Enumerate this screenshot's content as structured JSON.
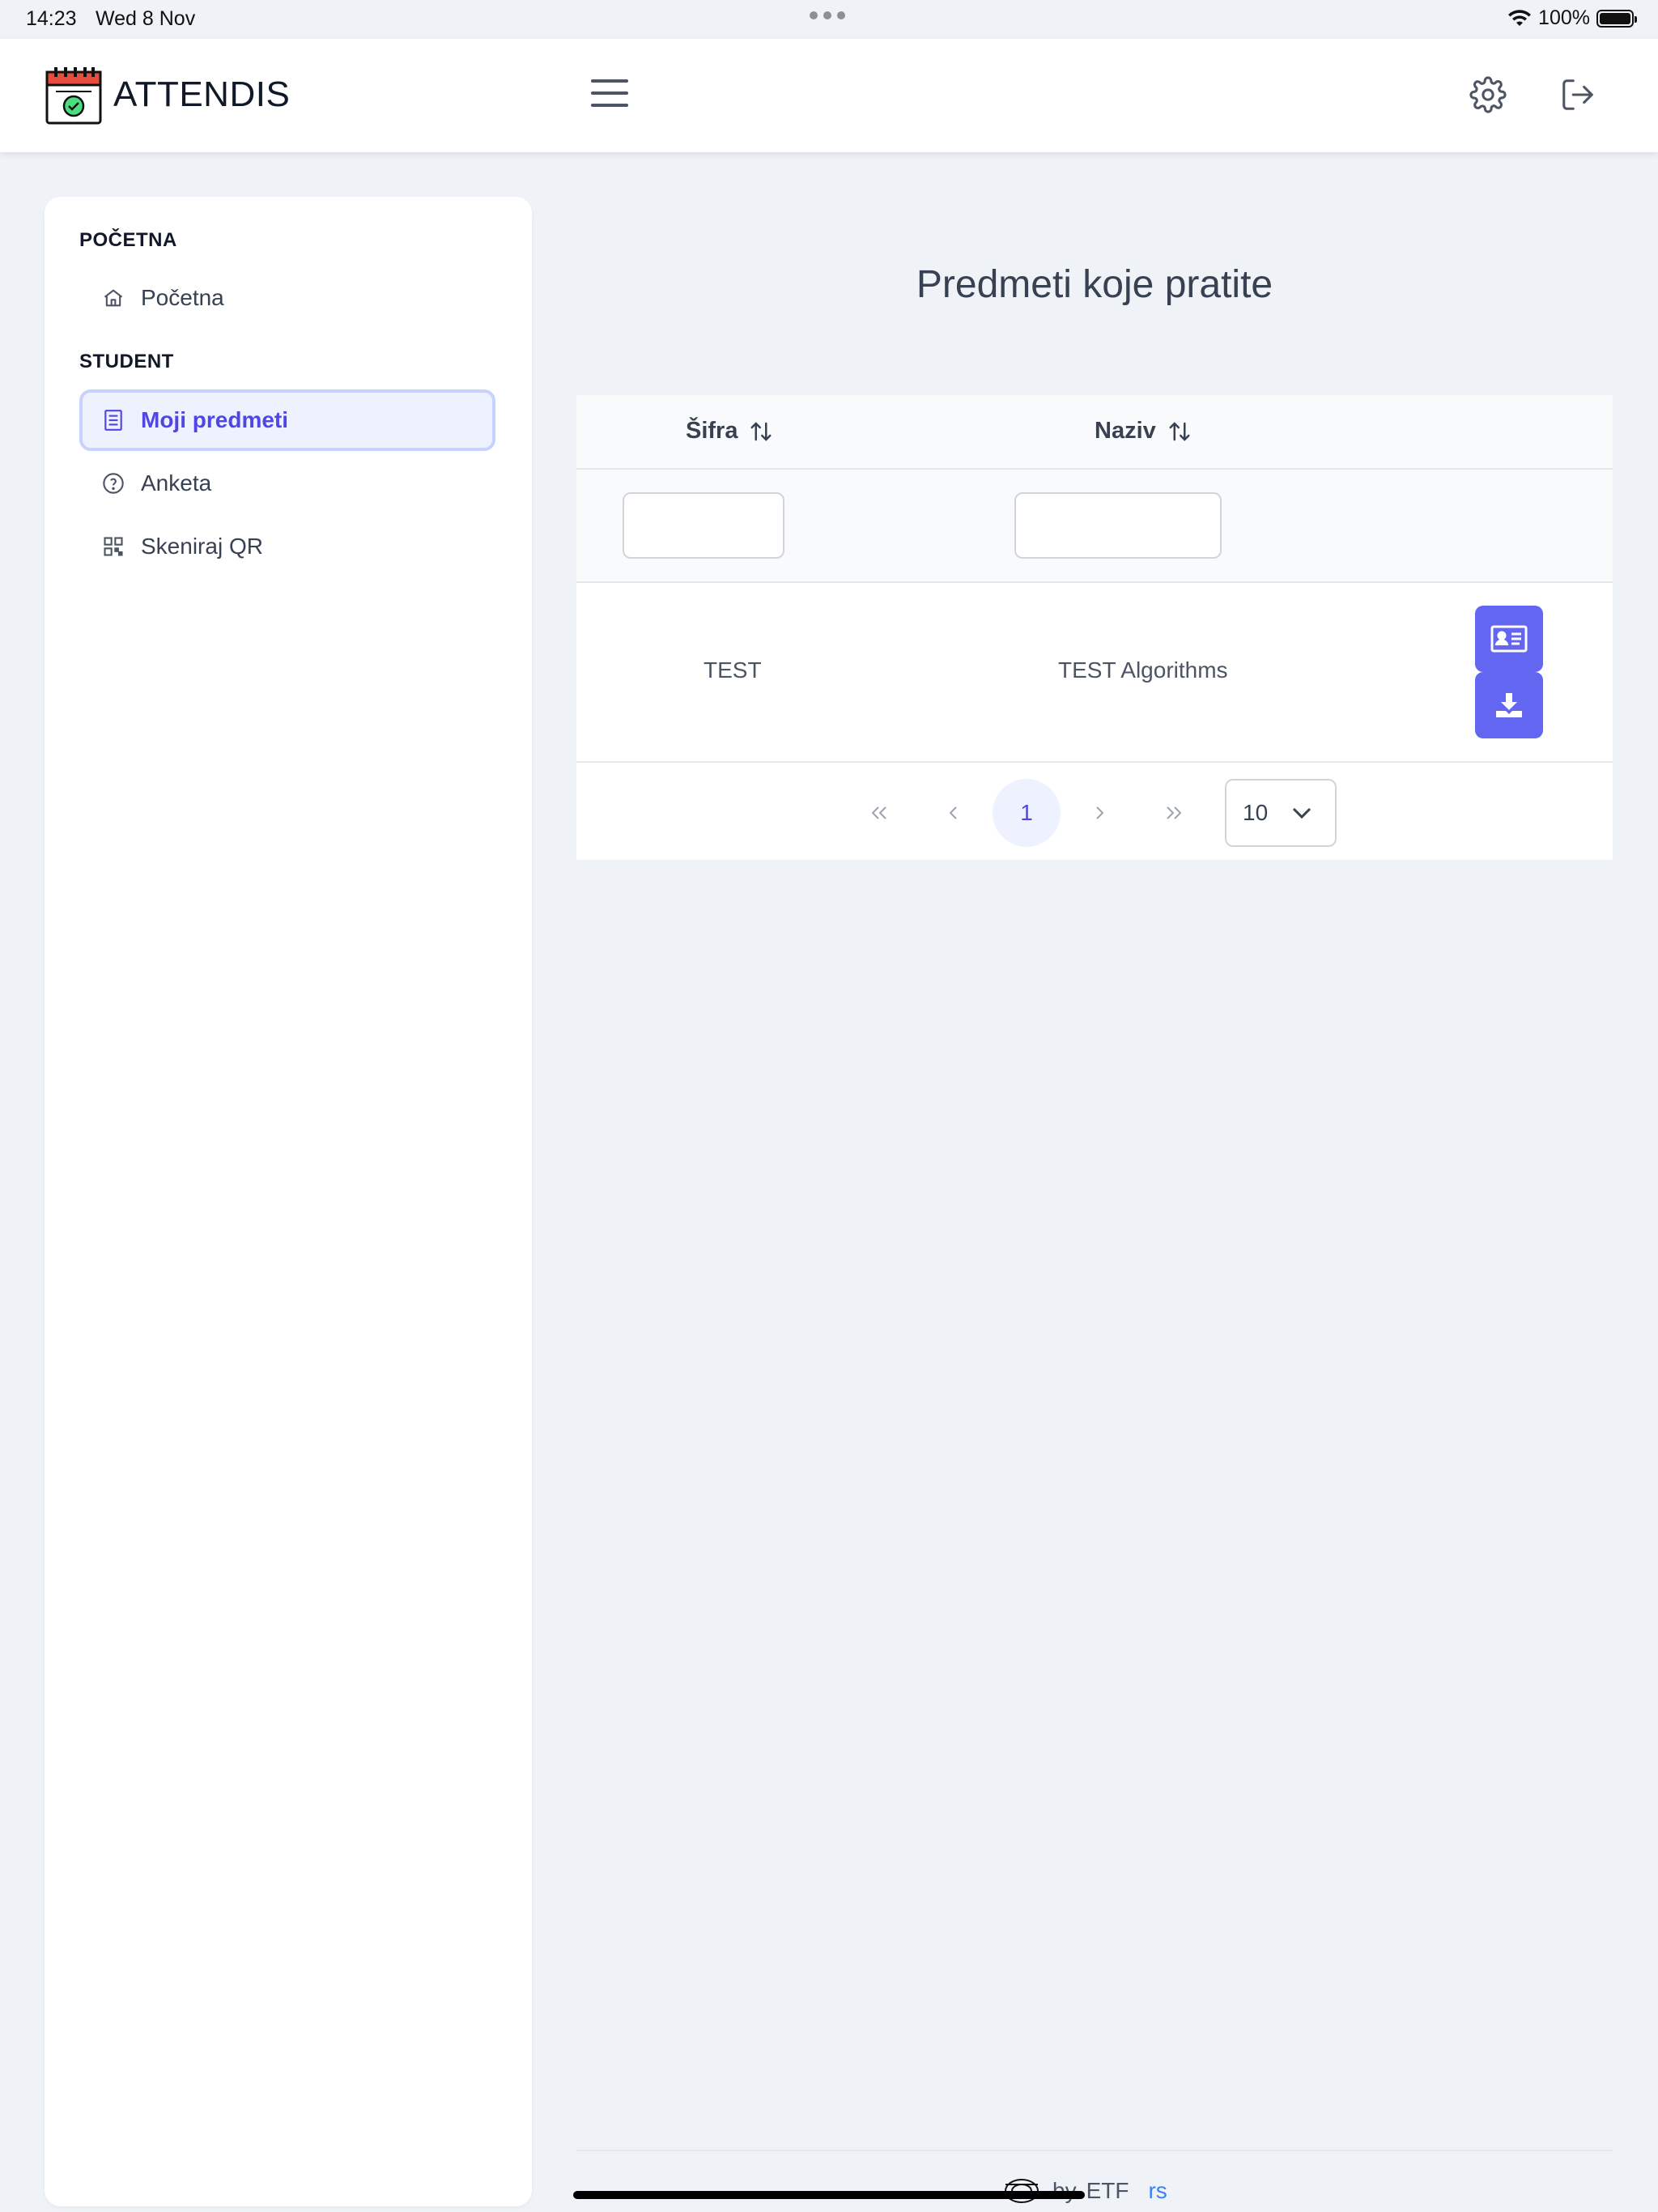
{
  "status_bar": {
    "time": "14:23",
    "date": "Wed 8 Nov",
    "battery": "100%"
  },
  "header": {
    "brand": "ATTENDIS"
  },
  "sidebar": {
    "sections": [
      {
        "title": "POČETNA",
        "items": [
          {
            "label": "Početna",
            "icon": "home-icon"
          }
        ]
      },
      {
        "title": "STUDENT",
        "items": [
          {
            "label": "Moji predmeti",
            "icon": "book-icon",
            "active": true
          },
          {
            "label": "Anketa",
            "icon": "question-circle-icon"
          },
          {
            "label": "Skeniraj QR",
            "icon": "qrcode-icon"
          }
        ]
      }
    ]
  },
  "main": {
    "title": "Predmeti koje pratite",
    "table": {
      "columns": [
        "Šifra",
        "Naziv"
      ],
      "rows": [
        {
          "code": "TEST",
          "name": "TEST Algorithms"
        }
      ]
    },
    "paginator": {
      "current_page": "1",
      "rows_per_page": "10"
    }
  },
  "footer": {
    "by": "by",
    "org": "ETF",
    "lang": "rs"
  },
  "colors": {
    "accent": "#6366f1",
    "background": "#eff3f8",
    "active_text": "#4f46e5"
  }
}
